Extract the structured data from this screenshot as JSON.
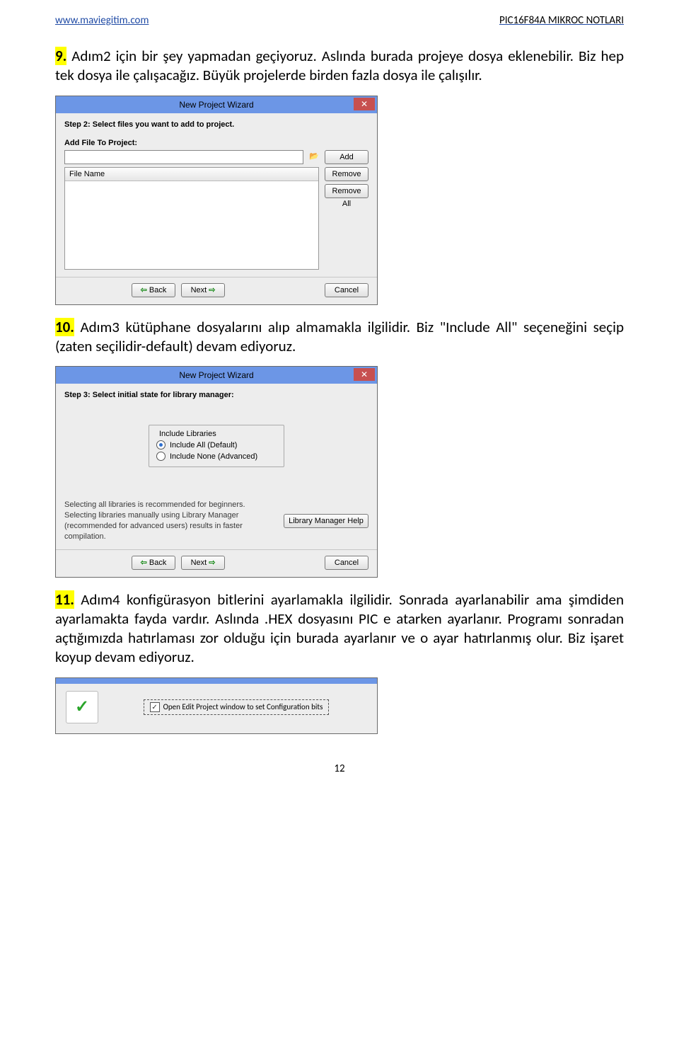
{
  "header": {
    "left": "www.maviegitim.com",
    "right": "PIC16F84A MIKROC NOTLARI"
  },
  "para9": {
    "num": "9.",
    "text": " Adım2 için bir şey yapmadan geçiyoruz. Aslında burada projeye dosya eklenebilir. Biz hep tek dosya ile çalışacağız. Büyük projelerde birden fazla dosya ile çalışılır."
  },
  "wiz1": {
    "title": "New Project Wizard",
    "step": "Step 2: Select files you want to add to project.",
    "addfile_label": "Add File To Project:",
    "add": "Add",
    "remove": "Remove",
    "removeall": "Remove All",
    "filehdr": "File Name",
    "back": "Back",
    "next": "Next",
    "cancel": "Cancel"
  },
  "para10": {
    "num": "10.",
    "text": " Adım3 kütüphane dosyalarını alıp almamakla ilgilidir. Biz \"Include All\" seçeneğini seçip (zaten seçilidir-default) devam ediyoruz."
  },
  "wiz2": {
    "title": "New Project Wizard",
    "step": "Step 3: Select initial state for library manager:",
    "group": "Include Libraries",
    "opt1": "Include All (Default)",
    "opt2": "Include None (Advanced)",
    "helptext": "Selecting all libraries is recommended for beginners.\nSelecting libraries manually using Library Manager (recommended for advanced users) results in faster compilation.",
    "helpbtn": "Library Manager Help",
    "back": "Back",
    "next": "Next",
    "cancel": "Cancel"
  },
  "para11": {
    "num": "11.",
    "text": " Adım4 konfigürasyon bitlerini ayarlamakla ilgilidir. Sonrada ayarlanabilir ama şimdiden ayarlamakta fayda vardır. Aslında .HEX dosyasını PIC e atarken ayarlanır. Programı sonradan açtığımızda hatırlaması zor olduğu için burada ayarlanır ve o ayar hatırlanmış olur. Biz işaret koyup devam ediyoruz."
  },
  "snippet3": {
    "checkmark": "✓",
    "label": "Open Edit Project window to set Configuration bits"
  },
  "page_number": "12"
}
